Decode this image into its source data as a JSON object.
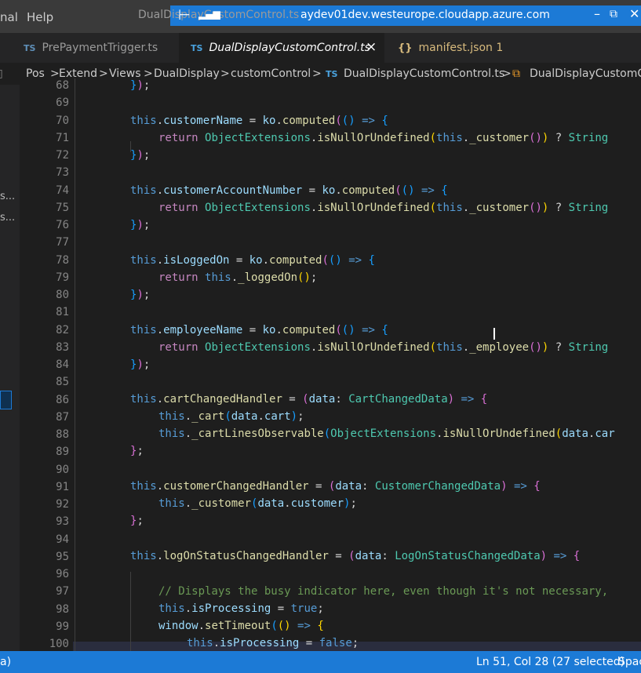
{
  "titlebar": {
    "menu": [
      "nal",
      "Help"
    ],
    "ghost_tab": "DualDisplayCustomControl.ts",
    "remote_host": "aydev01dev.westeurope.cloudapp.azure.com"
  },
  "tabs": [
    {
      "lang": "TS",
      "label": "PrePaymentTrigger.ts"
    },
    {
      "lang": "TS",
      "label": "DualDisplayCustomControl.ts",
      "close": "×"
    },
    {
      "lang": "{}",
      "label": "manifest.json 1"
    }
  ],
  "breadcrumb": [
    "Pos",
    "Extend",
    "Views",
    "DualDisplay",
    "customControl",
    "DualDisplayCustomControl.ts",
    "DualDisplayCustomC"
  ],
  "breadcrumb_sep": ">",
  "sidebar_frags": [
    "s...",
    "s..."
  ],
  "line_numbers": [
    "68",
    "69",
    "70",
    "71",
    "72",
    "73",
    "74",
    "75",
    "76",
    "77",
    "78",
    "79",
    "80",
    "81",
    "82",
    "83",
    "84",
    "85",
    "86",
    "87",
    "88",
    "89",
    "90",
    "91",
    "92",
    "93",
    "94",
    "95",
    "96",
    "97",
    "98",
    "99",
    "100"
  ],
  "code": {
    "l68": "});",
    "l70": "this.customerName = ko.computed(() => {",
    "l71": "return ObjectExtensions.isNullOrUndefined(this._customer()) ? String",
    "l72": "});",
    "l74": "this.customerAccountNumber = ko.computed(() => {",
    "l75": "return ObjectExtensions.isNullOrUndefined(this._customer()) ? String",
    "l76": "});",
    "l78": "this.isLoggedOn = ko.computed(() => {",
    "l79": "return this._loggedOn();",
    "l80": "});",
    "l82": "this.employeeName = ko.computed(() => {",
    "l83": "return ObjectExtensions.isNullOrUndefined(this._employee()) ? String",
    "l84": "});",
    "l86": "this.cartChangedHandler = (data: CartChangedData) => {",
    "l87": "this._cart(data.cart);",
    "l88": "this._cartLinesObservable(ObjectExtensions.isNullOrUndefined(data.car",
    "l89": "};",
    "l91": "this.customerChangedHandler = (data: CustomerChangedData) => {",
    "l92": "this._customer(data.customer);",
    "l93": "};",
    "l95": "this.logOnStatusChangedHandler = (data: LogOnStatusChangedData) => {",
    "l97": "// Displays the busy indicator here, even though it's not necessary,",
    "l98": "this.isProcessing = true;",
    "l99": "window.setTimeout(() => {",
    "l100": "this.isProcessing = false;"
  },
  "status": {
    "left": "a)",
    "position": "Ln 51, Col 28 (27 selected)",
    "right": "Spac"
  },
  "colors": {
    "accent": "#1c7ad6",
    "editor_bg": "#1e1e1e",
    "keyword": "#569cd6",
    "function": "#dcdcaa",
    "type": "#4ec9b0",
    "comment": "#6a9955"
  }
}
